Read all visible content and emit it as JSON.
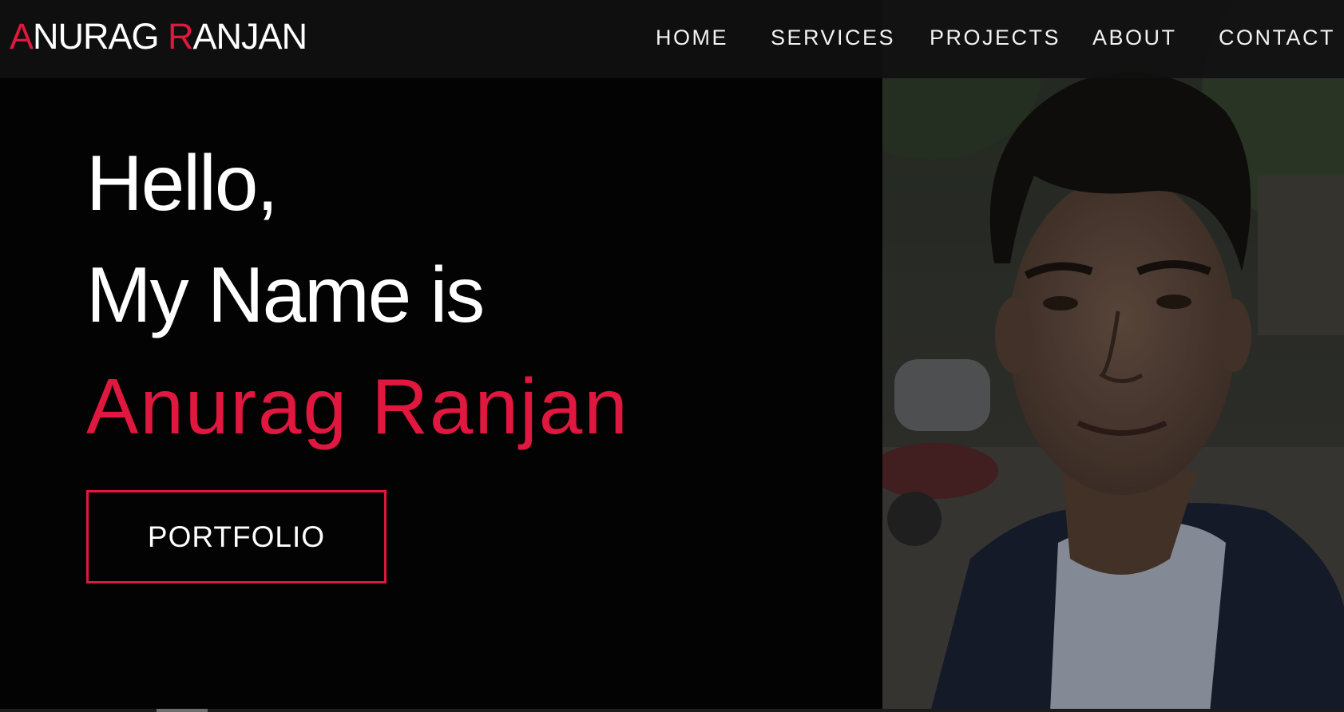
{
  "brand": {
    "logo_first_initial": "A",
    "logo_first_rest": "NURAG",
    "logo_last_initial": "R",
    "logo_last_rest": "ANJAN"
  },
  "nav": {
    "items": [
      {
        "label": "HOME"
      },
      {
        "label": "SERVICES"
      },
      {
        "label": "PROJECTS"
      },
      {
        "label": "ABOUT"
      },
      {
        "label": "CONTACT"
      }
    ]
  },
  "hero": {
    "greeting": "Hello,",
    "intro": "My Name is",
    "name": "Anurag Ranjan",
    "cta_label": "PORTFOLIO"
  },
  "colors": {
    "accent": "#e0173f",
    "background": "#030303",
    "navbar": "#101010",
    "text": "#ffffff"
  },
  "icons": {
    "profile_photo": "person-portrait-photo"
  }
}
